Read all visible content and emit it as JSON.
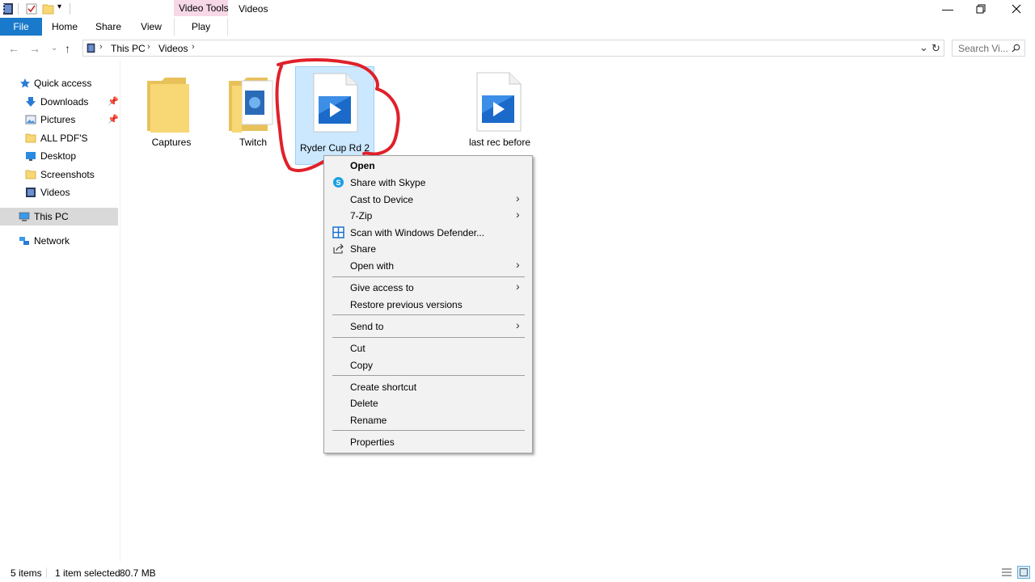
{
  "window": {
    "title": "Videos",
    "context_tab_group": "Video Tools"
  },
  "ribbon": {
    "tabs": [
      "File",
      "Home",
      "Share",
      "View",
      "Play"
    ]
  },
  "address": {
    "crumbs": [
      "This PC",
      "Videos"
    ],
    "search_placeholder": "Search Vi..."
  },
  "nav": {
    "items": [
      {
        "label": "Quick access",
        "icon": "star-icon"
      },
      {
        "label": "Downloads",
        "icon": "download-arrow-icon",
        "pinned": true
      },
      {
        "label": "Pictures",
        "icon": "pictures-icon",
        "pinned": true
      },
      {
        "label": "ALL PDF'S",
        "icon": "folder-icon"
      },
      {
        "label": "Desktop",
        "icon": "desktop-icon"
      },
      {
        "label": "Screenshots",
        "icon": "folder-icon"
      },
      {
        "label": "Videos",
        "icon": "video-folder-icon"
      },
      {
        "label": "This PC",
        "icon": "computer-icon"
      },
      {
        "label": "Network",
        "icon": "network-icon"
      }
    ]
  },
  "files": [
    {
      "name": "Captures",
      "type": "folder"
    },
    {
      "name": "Twitch",
      "type": "media-folder"
    },
    {
      "name": "Ryder Cup Rd 2",
      "type": "video",
      "selected": true
    },
    {
      "name": "last rec before",
      "type": "video"
    }
  ],
  "context_menu": {
    "groups": [
      [
        {
          "label": "Open",
          "bold": true
        },
        {
          "label": "Share with Skype",
          "icon": "skype-icon"
        },
        {
          "label": "Cast to Device",
          "submenu": true
        },
        {
          "label": "7-Zip",
          "submenu": true
        },
        {
          "label": "Scan with Windows Defender...",
          "icon": "defender-icon"
        },
        {
          "label": "Share",
          "icon": "share-icon"
        },
        {
          "label": "Open with",
          "submenu": true
        }
      ],
      [
        {
          "label": "Give access to",
          "submenu": true
        },
        {
          "label": "Restore previous versions"
        }
      ],
      [
        {
          "label": "Send to",
          "submenu": true
        }
      ],
      [
        {
          "label": "Cut"
        },
        {
          "label": "Copy"
        }
      ],
      [
        {
          "label": "Create shortcut"
        },
        {
          "label": "Delete"
        },
        {
          "label": "Rename"
        }
      ],
      [
        {
          "label": "Properties"
        }
      ]
    ]
  },
  "status": {
    "item_count": "5 items",
    "selection": "1 item selected",
    "size": "80.7 MB"
  },
  "colors": {
    "file_tab": "#1979ca",
    "video_tools": "#f7d8e6",
    "selection": "#cce8ff",
    "annotation": "#e0202a",
    "folder": "#f8d775"
  }
}
